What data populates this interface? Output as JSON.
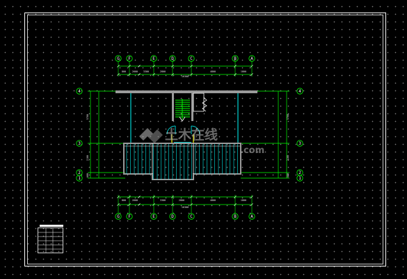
{
  "drawing": {
    "background_color": "#000000",
    "line_color": "#ffffff",
    "dimension_color": "#00ff00",
    "column_color": "#00ffff",
    "stair_color": "#00ff00",
    "door_color": "#ffff00"
  },
  "grid_axes": {
    "top": [
      "G",
      "F",
      "E",
      "D",
      "C",
      "B",
      "A"
    ],
    "bottom": [
      "G",
      "F",
      "E",
      "D",
      "C",
      "B",
      "A"
    ],
    "left": [
      "4",
      "3",
      "2",
      "1"
    ],
    "right": [
      "4",
      "3",
      "2",
      "1"
    ]
  },
  "dimensions": {
    "top_segments": [
      "800",
      "2600",
      "3300",
      "2800",
      "4800",
      "1800"
    ],
    "top_total": "16300",
    "bottom_segments": [
      "800",
      "2600",
      "3300",
      "2800",
      "4800",
      "1800"
    ],
    "bottom_total": "16300",
    "left_segments": [
      "5700",
      "2100",
      "600"
    ],
    "right_segments": [
      "5700",
      "2100",
      "600"
    ]
  },
  "watermark": {
    "text": "土木在线",
    "sub_text": ".com"
  },
  "legend": {
    "rows": [
      [
        "",
        "",
        ""
      ],
      [
        "",
        "",
        ""
      ],
      [
        "",
        "",
        ""
      ],
      [
        "",
        "",
        ""
      ],
      [
        "",
        "",
        ""
      ]
    ]
  }
}
